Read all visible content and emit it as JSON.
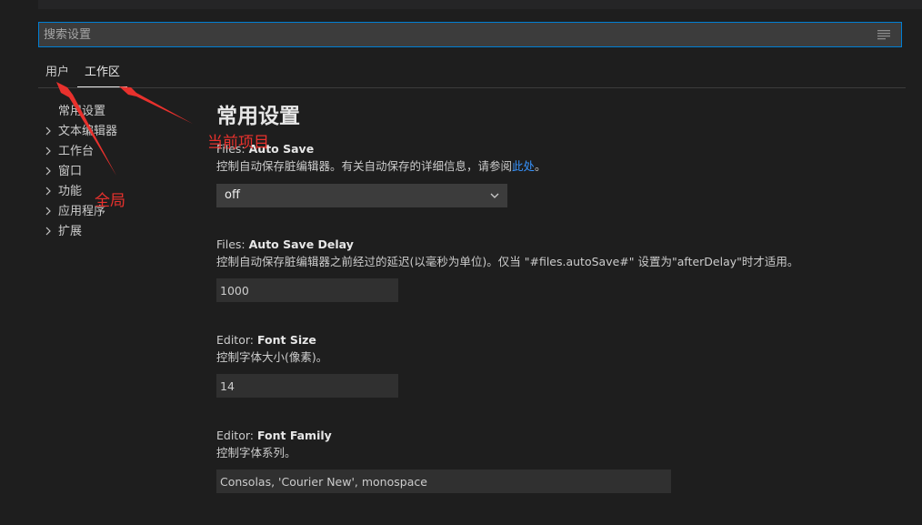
{
  "search": {
    "placeholder": "搜索设置"
  },
  "tabs": [
    {
      "label": "用户"
    },
    {
      "label": "工作区"
    }
  ],
  "toc": [
    {
      "label": "常用设置",
      "expandable": false
    },
    {
      "label": "文本编辑器",
      "expandable": true
    },
    {
      "label": "工作台",
      "expandable": true
    },
    {
      "label": "窗口",
      "expandable": true
    },
    {
      "label": "功能",
      "expandable": true
    },
    {
      "label": "应用程序",
      "expandable": true
    },
    {
      "label": "扩展",
      "expandable": true
    }
  ],
  "content": {
    "section_title": "常用设置",
    "settings": [
      {
        "category": "Files: ",
        "key": "Auto Save",
        "description": "控制自动保存脏编辑器。有关自动保存的详细信息，请参阅",
        "link_text": "此处",
        "description_suffix": "。",
        "value": "off"
      },
      {
        "category": "Files: ",
        "key": "Auto Save Delay",
        "description": "控制自动保存脏编辑器之前经过的延迟(以毫秒为单位)。仅当 \"#files.autoSave#\" 设置为\"afterDelay\"时才适用。",
        "value": "1000"
      },
      {
        "category": "Editor: ",
        "key": "Font Size",
        "description": "控制字体大小(像素)。",
        "value": "14"
      },
      {
        "category": "Editor: ",
        "key": "Font Family",
        "description": "控制字体系列。",
        "value": "Consolas, 'Courier New', monospace"
      }
    ]
  },
  "annotations": {
    "current_project": "当前项目",
    "global": "全局",
    "color": "#e8312d"
  },
  "icons": {
    "filter": "filter-lines-icon",
    "chevron_right": "chevron-right-icon",
    "chevron_down": "chevron-down-icon"
  },
  "colors": {
    "background": "#1e1e1e",
    "input_background": "#3c3c3c",
    "focus_border": "#007fd4",
    "link": "#3794ff"
  }
}
